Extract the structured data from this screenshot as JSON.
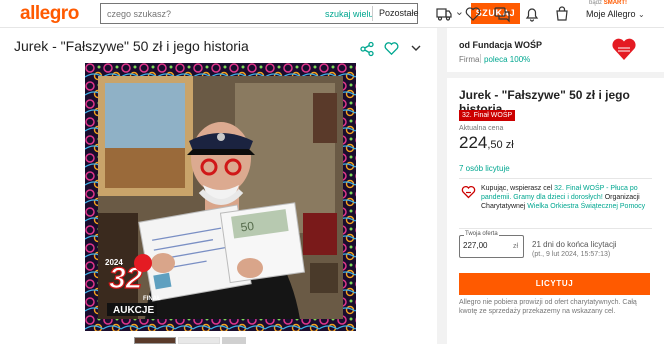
{
  "header": {
    "logo": "allegro",
    "search_placeholder": "czego szukasz?",
    "search_many": "szukaj wielu",
    "category": "Pozostałe",
    "search_button": "SZUKAJ",
    "smart_prefix": "bądź",
    "smart_brand": "SMART!",
    "account_label": "Moje Allegro"
  },
  "item": {
    "title": "Jurek - \"Fałszywe\" 50 zł i jego historia",
    "photo_logo_number": "32",
    "photo_logo_year": "2024",
    "photo_logo_line1": "FINAŁ",
    "photo_logo_line2": "AUKCJE"
  },
  "seller": {
    "name": "od Fundacja WOŚP",
    "type": "Firma",
    "recommend": "poleca 100%"
  },
  "offer": {
    "title": "Jurek - \"Fałszywe\" 50 zł i jego historia",
    "badge": "32. Finał WOŚP",
    "current_price_label": "Aktualna cena",
    "price_main": "224",
    "price_rest": ",50 zł",
    "bidders": "7 osób licytuje",
    "charity_1": "Kupując, wspierasz cel ",
    "charity_link": "32. Finał WOŚP - Płuca po pandemii. Gramy dla dzieci i dorosłych!",
    "charity_2": " Organizacji Charytatywnej ",
    "charity_org": "Wielka Orkiestra Świątecznej Pomocy",
    "bid_label": "Twoja oferta",
    "bid_value": "227,00",
    "bid_currency": "zł",
    "ends_in": "21 dni do końca licytacji",
    "ends_date": "(pt., 9 lut 2024, 15:57:13)",
    "bid_button": "LICYTUJ",
    "note": "Allegro nie pobiera prowizji od ofert charytatywnych. Całą kwotę ze sprzedaży przekazemy na wskazany cel."
  },
  "colors": {
    "brand": "#ff5a00",
    "link": "#00a790",
    "wosp_red": "#c00000"
  },
  "icons": [
    "delivery-icon",
    "heart-icon",
    "messages-icon",
    "bell-icon",
    "cart-icon",
    "share-icon",
    "chevron-down-icon",
    "charity-heart-icon"
  ]
}
